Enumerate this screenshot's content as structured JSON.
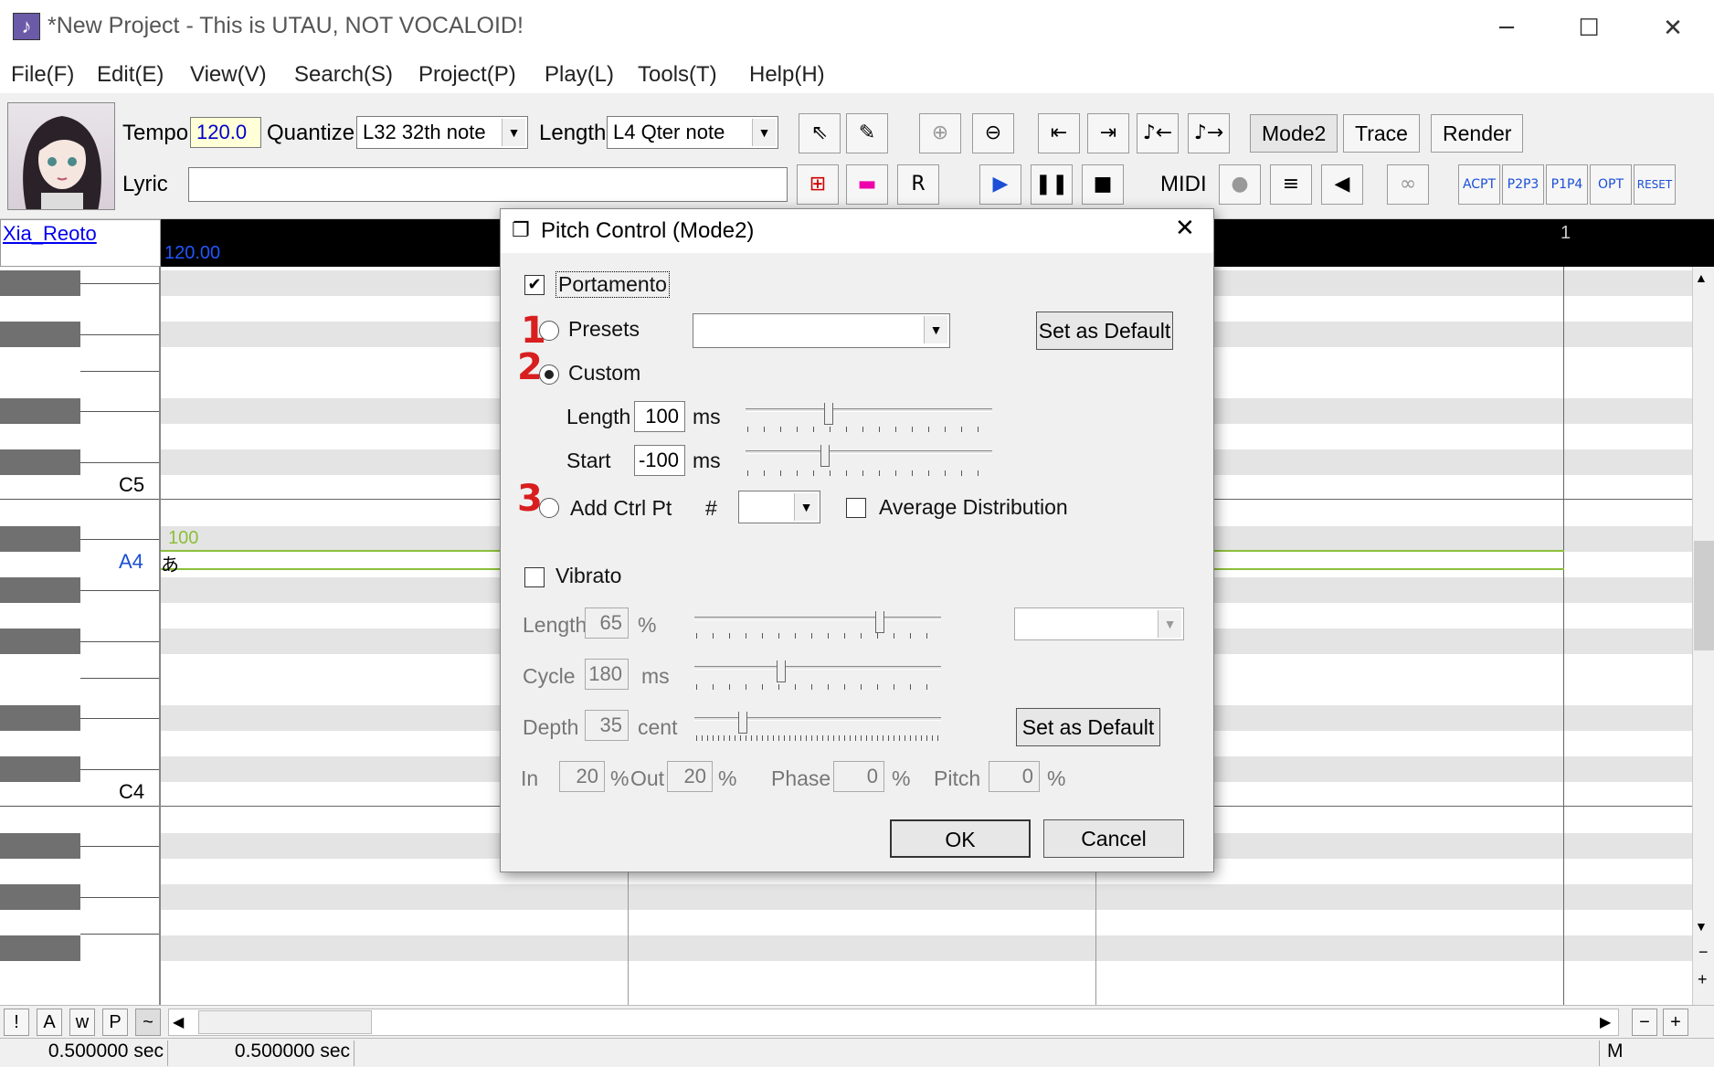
{
  "window": {
    "title": "*New Project - This is UTAU, NOT VOCALOID!",
    "minimize": "─",
    "maximize": "☐",
    "close": "✕",
    "icon": "♪"
  },
  "menu": [
    "File(F)",
    "Edit(E)",
    "View(V)",
    "Search(S)",
    "Project(P)",
    "Play(L)",
    "Tools(T)",
    "Help(H)"
  ],
  "toolbar": {
    "tempo_label": "Tempo",
    "tempo_value": "120.0",
    "quantize_label": "Quantize",
    "quantize_value": "L32 32th note",
    "length_label": "Length",
    "length_value": "L4  Qter note",
    "lyric_label": "Lyric",
    "lyric_value": "",
    "mode2": "Mode2",
    "trace": "Trace",
    "render": "Render",
    "midi": "MIDI",
    "icons": [
      "pointer-icon",
      "pencil-icon",
      "zoom-in-icon",
      "zoom-out-icon",
      "jump-start-icon",
      "jump-end-icon",
      "shrink-icon",
      "stretch-icon"
    ]
  },
  "pianoroll": {
    "singer": "Xia_Reoto",
    "ruler_tempo": "120.00",
    "ruler_measure": "1",
    "labels": {
      "c5": "C5",
      "a4": "A4",
      "c4": "C4"
    },
    "note": {
      "lyric": "あ",
      "velocity": "100"
    }
  },
  "bottombar": {
    "buttons": [
      "!",
      "A",
      "w",
      "P",
      "~"
    ],
    "minus": "−",
    "plus": "+"
  },
  "status": {
    "time1": "0.500000 sec",
    "time2": "0.500000 sec",
    "mode": "M"
  },
  "dialog": {
    "title": "Pitch Control (Mode2)",
    "portamento": "Portamento",
    "presets": "Presets",
    "set_default": "Set as Default",
    "custom": "Custom",
    "length_label": "Length",
    "length_value": "100",
    "ms": "ms",
    "start_label": "Start",
    "start_value": "-100",
    "add_ctrl": "Add Ctrl Pt",
    "hash": "#",
    "avg_dist": "Average Distribution",
    "vibrato": "Vibrato",
    "v_length": "Length",
    "v_length_value": "65",
    "percent": "%",
    "cycle": "Cycle",
    "cycle_value": "180",
    "depth": "Depth",
    "depth_value": "35",
    "cent": "cent",
    "in": "In",
    "in_value": "20",
    "out": "Out",
    "out_value": "20",
    "phase": "Phase",
    "phase_value": "0",
    "pitch": "Pitch",
    "pitch_value": "0",
    "ok": "OK",
    "cancel": "Cancel",
    "annotations": [
      "1",
      "2",
      "3"
    ]
  }
}
